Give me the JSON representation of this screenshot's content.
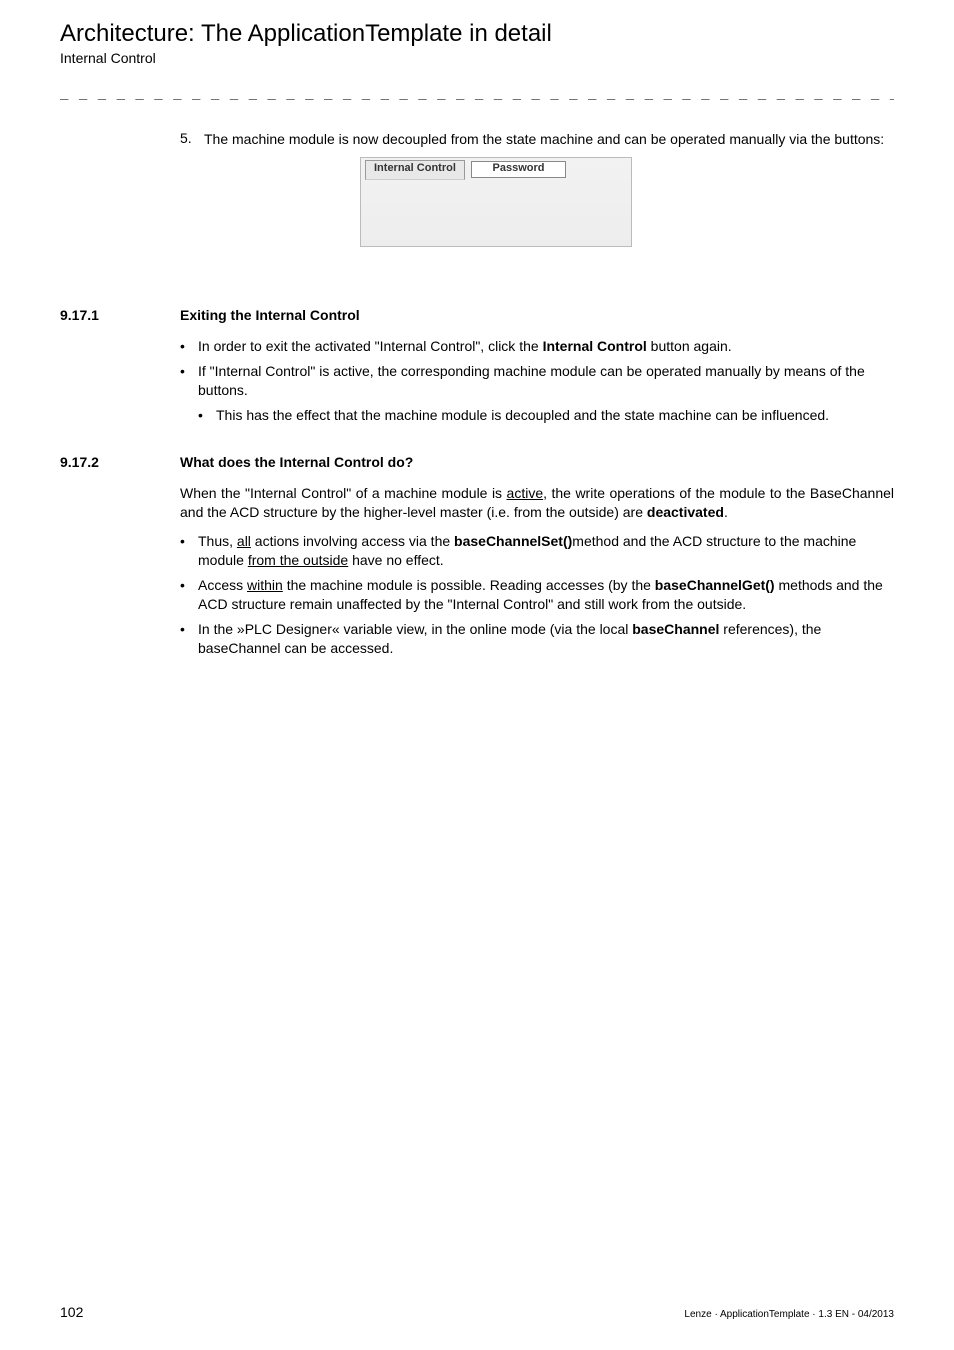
{
  "header": {
    "title": "Architecture: The ApplicationTemplate in detail",
    "subtitle": "Internal Control"
  },
  "dashline": "_ _ _ _ _ _ _ _ _ _ _ _ _ _ _ _ _ _ _ _ _ _ _ _ _ _ _ _ _ _ _ _ _ _ _ _ _ _ _ _ _ _ _ _ _ _ _ _ _ _ _ _ _ _ _ _ _ _ _ _ _ _ _ _",
  "step5": {
    "num": "5.",
    "text": "The machine module is now decoupled from the state machine and can be operated manually via the buttons:"
  },
  "ui": {
    "tab": "Internal Control",
    "input": "Password"
  },
  "sec9171": {
    "num": "9.17.1",
    "title": "Exiting the Internal Control",
    "b1_a": "In order to exit the activated \"Internal Control\", click the ",
    "b1_b": "Internal Control",
    "b1_c": " button again.",
    "b2": "If \"Internal Control\" is active, the corresponding machine module can be operated manually by means of the buttons.",
    "b2s1": "This has the effect that the machine module is decoupled and the state machine can be influenced."
  },
  "sec9172": {
    "num": "9.17.2",
    "title": "What does the Internal Control do?",
    "para_a": "When the \"Internal Control\" of a machine module is ",
    "para_b": "active",
    "para_c": ", the write operations of the module to the BaseChannel and the ACD structure by the higher-level master (i.e. from the outside) are ",
    "para_d": "deactivated",
    "para_e": ".",
    "b1_a": "Thus, ",
    "b1_b": "all",
    "b1_c": " actions involving access via the ",
    "b1_d": "baseChannelSet()",
    "b1_e": "method and the ACD structure to the machine module ",
    "b1_f": "from the outside",
    "b1_g": " have no effect.",
    "b2_a": "Access ",
    "b2_b": "within",
    "b2_c": " the machine module is possible. Reading accesses (by the ",
    "b2_d": "baseChannelGet()",
    "b2_e": " methods and the ACD structure remain unaffected by the \"Internal Control\" and still work from the outside.",
    "b3_a": "In the »PLC Designer« variable view, in the online mode (via the local ",
    "b3_b": "baseChannel",
    "b3_c": " references), the baseChannel can be accessed."
  },
  "footer": {
    "page": "102",
    "right": "Lenze · ApplicationTemplate · 1.3 EN - 04/2013"
  }
}
